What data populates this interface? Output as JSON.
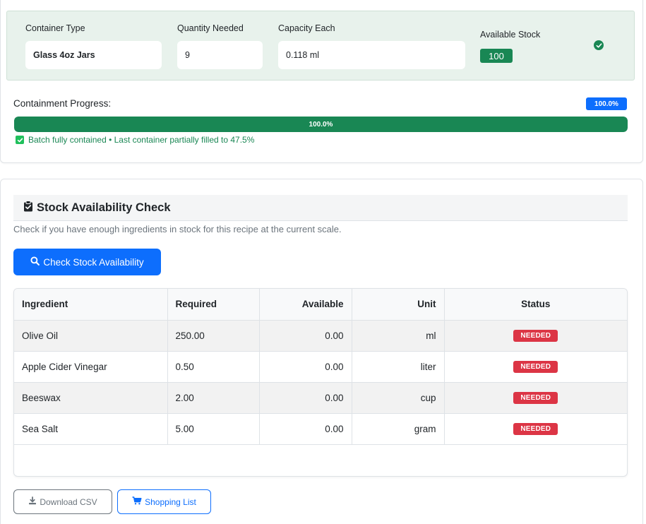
{
  "container": {
    "type_label": "Container Type",
    "type_value": "Glass 4oz Jars",
    "qty_label": "Quantity Needed",
    "qty_value": "9",
    "cap_label": "Capacity Each",
    "cap_value": "0.118 ml",
    "stock_label": "Available Stock",
    "stock_value": "100",
    "status_icon": "check-circle-icon"
  },
  "progress": {
    "label": "Containment Progress:",
    "pill": "100.0%",
    "bar_text": "100.0%",
    "fraction": 1.0,
    "note": "Batch fully contained • Last container partially filled to 47.5%"
  },
  "stock_check": {
    "title": "Stock Availability Check",
    "title_icon": "clipboard-check-icon",
    "description": "Check if you have enough ingredients in stock for this recipe at the current scale.",
    "button_label": "Check Stock Availability",
    "button_icon": "search-icon",
    "columns": [
      "Ingredient",
      "Required",
      "Available",
      "Unit",
      "Status"
    ],
    "rows": [
      {
        "ingredient": "Olive Oil",
        "required": "250.00",
        "available": "0.00",
        "unit": "ml",
        "status": "NEEDED"
      },
      {
        "ingredient": "Apple Cider Vinegar",
        "required": "0.50",
        "available": "0.00",
        "unit": "liter",
        "status": "NEEDED"
      },
      {
        "ingredient": "Beeswax",
        "required": "2.00",
        "available": "0.00",
        "unit": "cup",
        "status": "NEEDED"
      },
      {
        "ingredient": "Sea Salt",
        "required": "5.00",
        "available": "0.00",
        "unit": "gram",
        "status": "NEEDED"
      }
    ]
  },
  "actions": {
    "download_label": "Download CSV",
    "download_icon": "download-icon",
    "shopping_label": "Shopping List",
    "shopping_icon": "cart-icon"
  },
  "colors": {
    "success": "#198754",
    "primary": "#0d6efd",
    "danger": "#dc3545"
  }
}
